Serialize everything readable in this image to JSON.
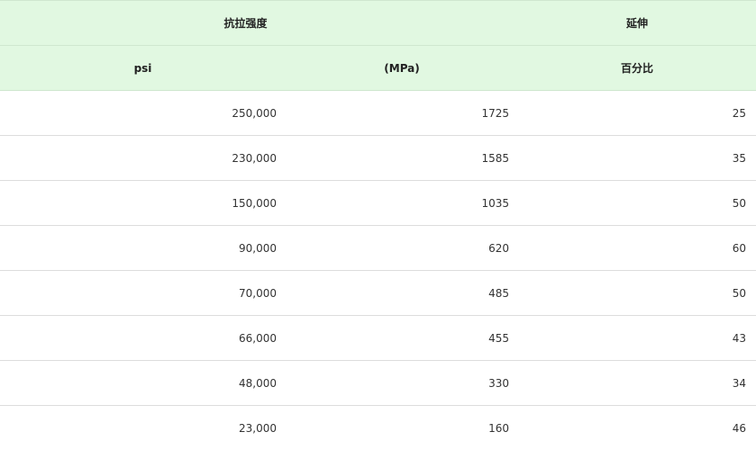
{
  "table": {
    "header_groups": {
      "tensile_strength": "抗拉强度",
      "elongation": "延伸"
    },
    "columns": [
      "psi",
      "(MPa)",
      "百分比"
    ],
    "rows": [
      {
        "psi": "250,000",
        "mpa": "1725",
        "percent": "25"
      },
      {
        "psi": "230,000",
        "mpa": "1585",
        "percent": "35"
      },
      {
        "psi": "150,000",
        "mpa": "1035",
        "percent": "50"
      },
      {
        "psi": "90,000",
        "mpa": "620",
        "percent": "60"
      },
      {
        "psi": "70,000",
        "mpa": "485",
        "percent": "50"
      },
      {
        "psi": "66,000",
        "mpa": "455",
        "percent": "43"
      },
      {
        "psi": "48,000",
        "mpa": "330",
        "percent": "34"
      },
      {
        "psi": "23,000",
        "mpa": "160",
        "percent": "46"
      }
    ]
  }
}
